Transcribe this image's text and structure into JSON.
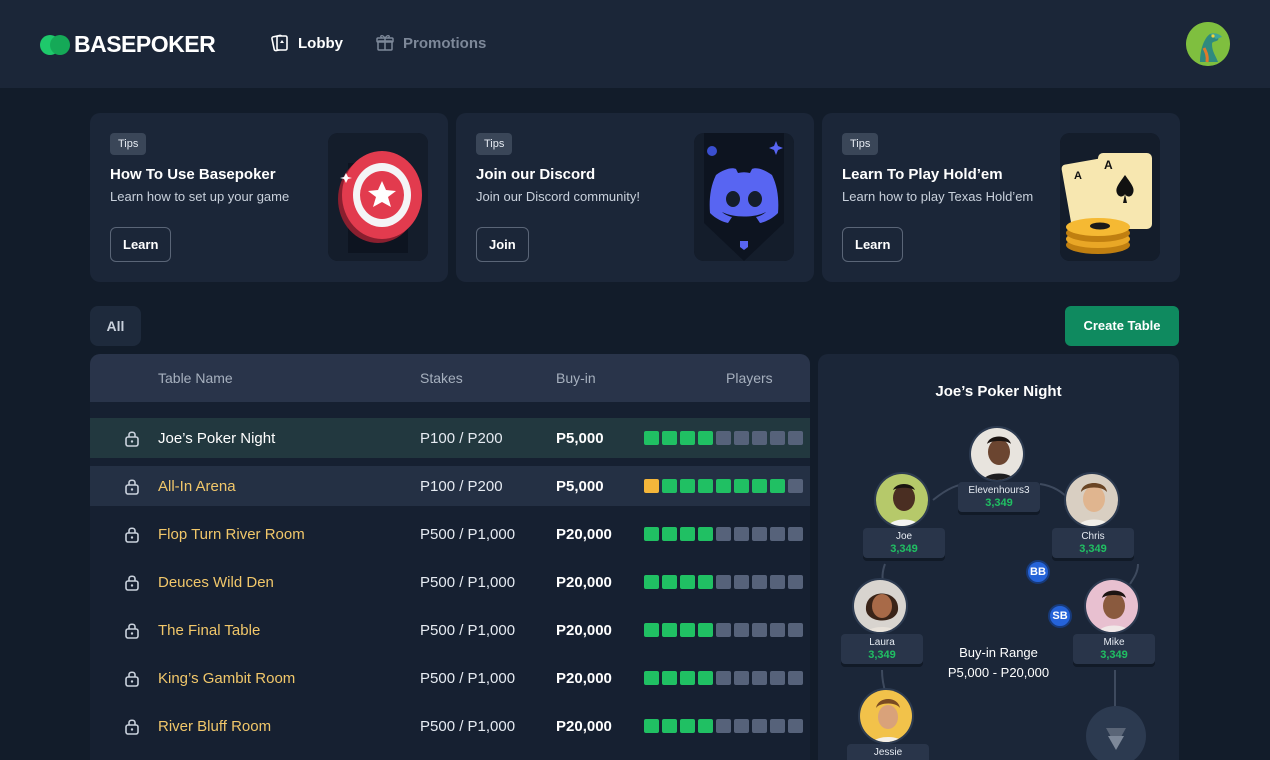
{
  "header": {
    "logo_text": "BASEPOKER",
    "nav": [
      {
        "label": "Lobby",
        "icon": "cards-icon",
        "active": true
      },
      {
        "label": "Promotions",
        "icon": "gift-icon",
        "active": false
      }
    ]
  },
  "tips": [
    {
      "badge": "Tips",
      "title": "How To Use Basepoker",
      "desc": "Learn how to set up your game",
      "button": "Learn",
      "art": "poker-chip-art"
    },
    {
      "badge": "Tips",
      "title": "Join our Discord",
      "desc": "Join our Discord community!",
      "button": "Join",
      "art": "discord-logo-art"
    },
    {
      "badge": "Tips",
      "title": "Learn To Play Hold’em",
      "desc": "Learn how to play Texas Hold’em",
      "button": "Learn",
      "art": "aces-cards-art"
    }
  ],
  "filter": {
    "all": "All"
  },
  "create_table": "Create Table",
  "table": {
    "headers": {
      "name": "Table Name",
      "stakes": "Stakes",
      "buyin": "Buy-in",
      "players": "Players"
    },
    "rows": [
      {
        "name": "Joe’s Poker Night",
        "stakes": "P100 / P200",
        "buyin": "P5,000",
        "seats": "gggg-----"
      },
      {
        "name": "All-In Arena",
        "stakes": "P100 / P200",
        "buyin": "P5,000",
        "seats": "yggggggg-"
      },
      {
        "name": "Flop Turn River Room",
        "stakes": "P500 / P1,000",
        "buyin": "P20,000",
        "seats": "gggg-----"
      },
      {
        "name": "Deuces Wild Den",
        "stakes": "P500 / P1,000",
        "buyin": "P20,000",
        "seats": "gggg-----"
      },
      {
        "name": "The Final Table",
        "stakes": "P500 / P1,000",
        "buyin": "P20,000",
        "seats": "gggg-----"
      },
      {
        "name": "King’s Gambit Room",
        "stakes": "P500 / P1,000",
        "buyin": "P20,000",
        "seats": "gggg-----"
      },
      {
        "name": "River Bluff Room",
        "stakes": "P500 / P1,000",
        "buyin": "P20,000",
        "seats": "gggg-----"
      }
    ]
  },
  "preview": {
    "title": "Joe’s Poker Night",
    "players": [
      {
        "name": "Elevenhours3",
        "chips": "3,349"
      },
      {
        "name": "Joe",
        "chips": "3,349"
      },
      {
        "name": "Chris",
        "chips": "3,349"
      },
      {
        "name": "Laura",
        "chips": "3,349"
      },
      {
        "name": "Mike",
        "chips": "3,349"
      },
      {
        "name": "Jessie",
        "chips": ""
      }
    ],
    "bb": "BB",
    "sb": "SB",
    "range_label": "Buy-in Range",
    "range_value": "P5,000 - P20,000"
  },
  "colors": {
    "background": "#121c2a",
    "accent_green": "#0f8a5f",
    "seat_filled": "#20c063",
    "seat_empty": "#56627a",
    "seat_active": "#f4b63a",
    "table_name": "#f1c76a"
  }
}
